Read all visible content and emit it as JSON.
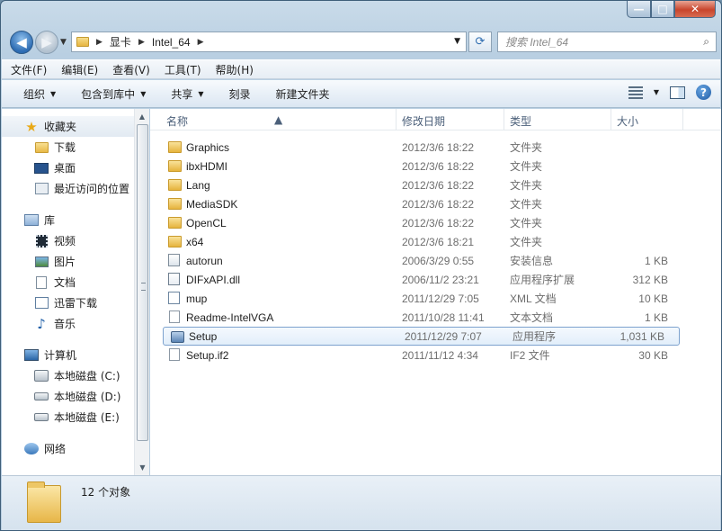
{
  "window": {
    "minimize_glyph": "—",
    "maximize_glyph": "□",
    "close_glyph": "✕"
  },
  "address": {
    "crumbs": [
      "显卡",
      "Intel_64"
    ],
    "search_placeholder": "搜索 Intel_64"
  },
  "menu": [
    "文件(F)",
    "编辑(E)",
    "查看(V)",
    "工具(T)",
    "帮助(H)"
  ],
  "toolbar": {
    "organize": "组织",
    "include_library": "包含到库中",
    "share": "共享",
    "burn": "刻录",
    "new_folder": "新建文件夹"
  },
  "sidebar": {
    "favorites": {
      "label": "收藏夹",
      "items": [
        "下载",
        "桌面",
        "最近访问的位置"
      ]
    },
    "libraries": {
      "label": "库",
      "items": [
        "视频",
        "图片",
        "文档",
        "迅雷下载",
        "音乐"
      ]
    },
    "computer": {
      "label": "计算机",
      "items": [
        "本地磁盘 (C:)",
        "本地磁盘 (D:)",
        "本地磁盘 (E:)"
      ]
    },
    "network": {
      "label": "网络"
    }
  },
  "columns": {
    "name": "名称",
    "date": "修改日期",
    "type": "类型",
    "size": "大小"
  },
  "files": [
    {
      "name": "Graphics",
      "date": "2012/3/6 18:22",
      "type": "文件夹",
      "size": "",
      "icon": "folder-icon"
    },
    {
      "name": "ibxHDMI",
      "date": "2012/3/6 18:22",
      "type": "文件夹",
      "size": "",
      "icon": "folder-icon"
    },
    {
      "name": "Lang",
      "date": "2012/3/6 18:22",
      "type": "文件夹",
      "size": "",
      "icon": "folder-icon"
    },
    {
      "name": "MediaSDK",
      "date": "2012/3/6 18:22",
      "type": "文件夹",
      "size": "",
      "icon": "folder-icon"
    },
    {
      "name": "OpenCL",
      "date": "2012/3/6 18:22",
      "type": "文件夹",
      "size": "",
      "icon": "folder-icon"
    },
    {
      "name": "x64",
      "date": "2012/3/6 18:21",
      "type": "文件夹",
      "size": "",
      "icon": "folder-icon"
    },
    {
      "name": "autorun",
      "date": "2006/3/29 0:55",
      "type": "安装信息",
      "size": "1 KB",
      "icon": "settings-file-icon"
    },
    {
      "name": "DIFxAPI.dll",
      "date": "2006/11/2 23:21",
      "type": "应用程序扩展",
      "size": "312 KB",
      "icon": "dll-file-icon"
    },
    {
      "name": "mup",
      "date": "2011/12/29 7:05",
      "type": "XML 文档",
      "size": "10 KB",
      "icon": "xml-file-icon"
    },
    {
      "name": "Readme-IntelVGA",
      "date": "2011/10/28 11:41",
      "type": "文本文档",
      "size": "1 KB",
      "icon": "text-file-icon"
    },
    {
      "name": "Setup",
      "date": "2011/12/29 7:07",
      "type": "应用程序",
      "size": "1,031 KB",
      "icon": "setup-exe-icon",
      "selected": true
    },
    {
      "name": "Setup.if2",
      "date": "2011/11/12 4:34",
      "type": "IF2 文件",
      "size": "30 KB",
      "icon": "blank-file-icon"
    }
  ],
  "status": {
    "count": "12 个对象"
  }
}
